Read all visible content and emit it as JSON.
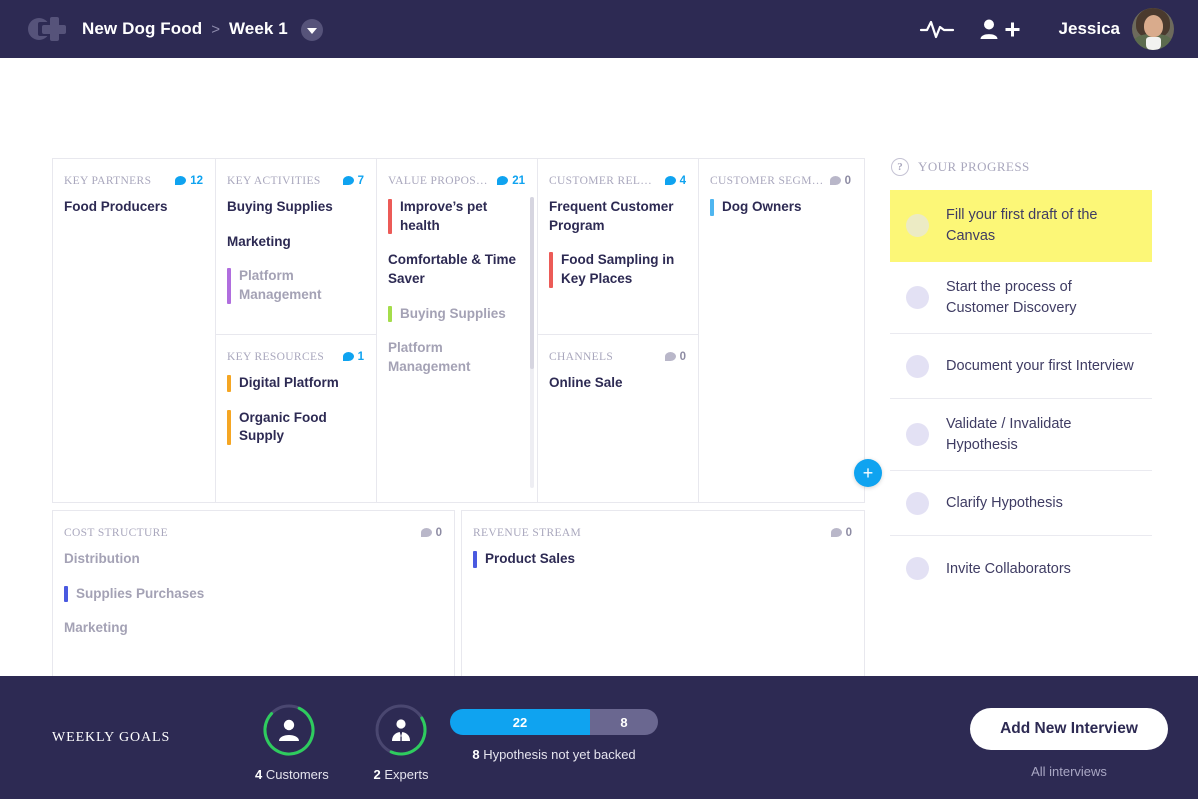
{
  "header": {
    "logo_icon": "cplus-logo-icon",
    "breadcrumb": {
      "project": "New Dog Food",
      "separator": ">",
      "week": "Week 1"
    },
    "dropdown_icon": "chevron-down-icon",
    "pulse_icon": "activity-pulse-icon",
    "add_user_icon": "add-user-icon",
    "user_name": "Jessica",
    "avatar_icon": "user-avatar"
  },
  "canvas": {
    "columns": [
      {
        "key": "key_partners",
        "title": "KEY PARTNERS",
        "count": "12",
        "count_active": true,
        "items": [
          {
            "text": "Food Producers",
            "dim": false,
            "accent": null
          }
        ]
      },
      {
        "key": "key_activities",
        "title": "KEY ACTIVITIES",
        "count": "7",
        "count_active": true,
        "items": [
          {
            "text": "Buying Supplies",
            "dim": false,
            "accent": null
          },
          {
            "text": "Marketing",
            "dim": false,
            "accent": null
          },
          {
            "text": "Platform Management",
            "dim": true,
            "accent": "#b06ede"
          }
        ]
      },
      {
        "key": "key_resources",
        "title": "KEY RESOURCES",
        "count": "1",
        "count_active": true,
        "items": [
          {
            "text": "Digital Platform",
            "dim": false,
            "accent": "#f5a623"
          },
          {
            "text": "Organic Food Supply",
            "dim": false,
            "accent": "#f5a623"
          }
        ]
      },
      {
        "key": "value_proposition",
        "title": "VALUE PROPOSITION",
        "count": "21",
        "count_active": true,
        "items": [
          {
            "text": "Improve’s pet health",
            "dim": false,
            "accent": "#ec5b57"
          },
          {
            "text": "Comfortable & Time Saver",
            "dim": false,
            "accent": null
          },
          {
            "text": "Buying Supplies",
            "dim": true,
            "accent": "#a4dd4b"
          },
          {
            "text": "Platform Management",
            "dim": true,
            "accent": null
          }
        ]
      },
      {
        "key": "customer_relations",
        "title": "CUSTOMER RELATION...",
        "count": "4",
        "count_active": true,
        "items": [
          {
            "text": "Frequent Customer Program",
            "dim": false,
            "accent": null
          },
          {
            "text": "Food Sampling in Key Places",
            "dim": false,
            "accent": "#ec5b57"
          }
        ]
      },
      {
        "key": "channels",
        "title": "CHANNELS",
        "count": "0",
        "count_active": false,
        "items": [
          {
            "text": "Online Sale",
            "dim": false,
            "accent": null
          }
        ]
      },
      {
        "key": "customer_segments",
        "title": "CUSTOMER SEGMENTS",
        "count": "0",
        "count_active": false,
        "items": [
          {
            "text": "Dog Owners",
            "dim": false,
            "accent": "#4fb6f0"
          }
        ]
      },
      {
        "key": "cost_structure",
        "title": "COST STRUCTURE",
        "count": "0",
        "count_active": false,
        "items": [
          {
            "text": "Distribution",
            "dim": true,
            "accent": null
          },
          {
            "text": "Supplies Purchases",
            "dim": true,
            "accent": "#4a5ae0"
          },
          {
            "text": "Marketing",
            "dim": true,
            "accent": null
          }
        ]
      },
      {
        "key": "revenue_stream",
        "title": "REVENUE STREAM",
        "count": "0",
        "count_active": false,
        "items": [
          {
            "text": "Product Sales",
            "dim": false,
            "accent": "#4a5ae0"
          }
        ]
      }
    ],
    "add_button_label": "+",
    "add_button_color": "#0fa3f0"
  },
  "progress": {
    "help_icon": "question-mark-icon",
    "title": "YOUR PROGRESS",
    "items": [
      {
        "label": "Fill your first draft of the Canvas",
        "active": true
      },
      {
        "label": "Start the process of Customer Discovery",
        "active": false
      },
      {
        "label": "Document your first Interview",
        "active": false
      },
      {
        "label": "Validate / Invalidate Hypothesis",
        "active": false
      },
      {
        "label": "Clarify Hypothesis",
        "active": false
      },
      {
        "label": "Invite Collaborators",
        "active": false
      }
    ],
    "highlight_color": "#fcf777"
  },
  "footer": {
    "weekly_goals_label": "WEEKLY GOALS",
    "rings": [
      {
        "icon": "customer-icon",
        "count": "4",
        "label": "Customers",
        "percent": 80,
        "color": "#2ecc5e"
      },
      {
        "icon": "expert-icon",
        "count": "2",
        "label": "Experts",
        "percent": 40,
        "color": "#2ecc5e"
      }
    ],
    "hypothesis": {
      "backed": "22",
      "not_backed": "8",
      "caption_count": "8",
      "caption_text": "Hypothesis not yet backed",
      "fill_color": "#0fa3f0",
      "rest_color": "#6a6790"
    },
    "add_interview_label": "Add New Interview",
    "all_interviews_label": "All interviews"
  }
}
